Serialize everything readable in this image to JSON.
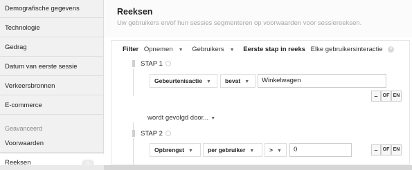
{
  "sidebar": {
    "items": [
      {
        "label": "Demografische gegevens"
      },
      {
        "label": "Technologie"
      },
      {
        "label": "Gedrag"
      },
      {
        "label": "Datum van eerste sessie"
      },
      {
        "label": "Verkeersbronnen"
      },
      {
        "label": "E-commerce"
      }
    ],
    "section_label": "Geavanceerd",
    "advanced_items": [
      {
        "label": "Voorwaarden"
      },
      {
        "label": "Reeksen",
        "count": "1",
        "active": true
      }
    ]
  },
  "main": {
    "title": "Reeksen",
    "subtitle": "Uw gebruikers en/of hun sessies segmenteren op voorwaarden voor sessiereeksen."
  },
  "filter": {
    "label": "Filter",
    "include": "Opnemen",
    "scope": "Gebruikers",
    "first_step_label": "Eerste stap in reeks",
    "first_step_value": "Elke gebruikersinteractie"
  },
  "step1": {
    "label": "STAP 1",
    "dimension": "Gebeurtenisactie",
    "operator": "bevat",
    "value": "Winkelwagen",
    "btn_minus": "–",
    "btn_or": "OF",
    "btn_and": "EN"
  },
  "followed_by": "wordt gevolgd door...",
  "step2": {
    "label": "STAP 2",
    "metric": "Opbrengst",
    "per": "per gebruiker",
    "operator": ">",
    "value": "0",
    "btn_minus": "–",
    "btn_or": "OF",
    "btn_and": "EN"
  },
  "icons": {
    "caret": "caret-down-icon",
    "circle_caret": "circle-caret-icon",
    "drag": "drag-handle-icon",
    "step_indicator": "step-circle-icon"
  }
}
